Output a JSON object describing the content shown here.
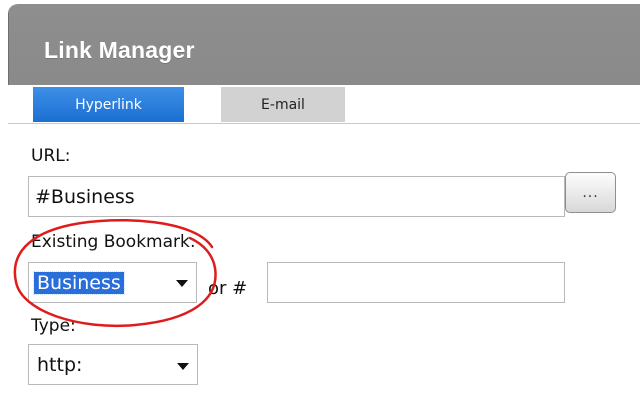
{
  "window": {
    "title": "Link Manager"
  },
  "tabs": [
    {
      "label": "Hyperlink",
      "active": true
    },
    {
      "label": "E-mail",
      "active": false
    }
  ],
  "url": {
    "label": "URL:",
    "value": "#Business",
    "browse_label": "..."
  },
  "bookmark": {
    "label": "Existing Bookmark:",
    "selected": "Business",
    "or_label": "or #",
    "custom_value": ""
  },
  "type": {
    "label": "Type:",
    "selected": "http:"
  },
  "colors": {
    "titlebar": "#8e8e8e",
    "active_tab": "#1a6fd2",
    "inactive_tab": "#d2d2d2",
    "selection": "#2a6fd9",
    "annotation": "#e01b1b"
  }
}
